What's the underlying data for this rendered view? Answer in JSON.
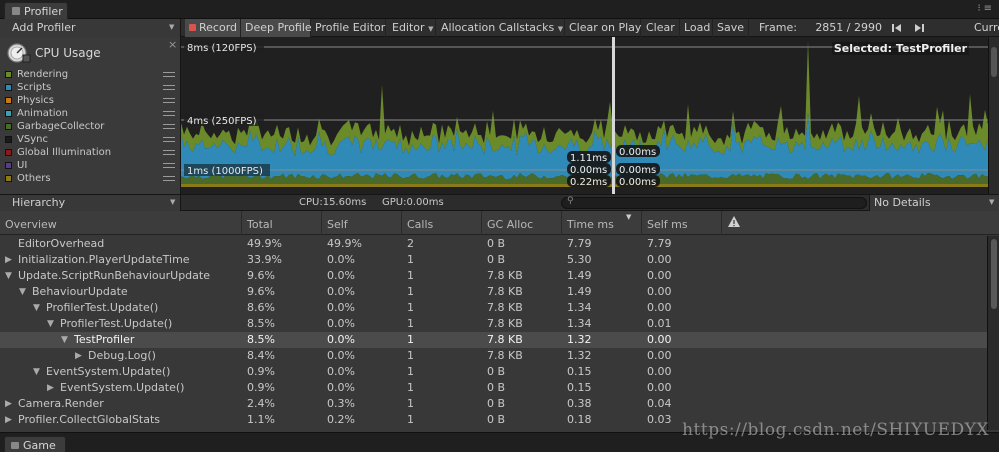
{
  "top_tab": {
    "label": "Profiler",
    "icon": "profiler-tab-icon"
  },
  "window_icons": "⁝≡",
  "toolbar": {
    "add_profiler": "Add Profiler",
    "record": "Record",
    "deep_profile": "Deep Profile",
    "profile_editor": "Profile Editor",
    "editor": "Editor",
    "allocation_callstacks": "Allocation Callstacks",
    "clear_on_play": "Clear on Play",
    "clear": "Clear",
    "load": "Load",
    "save": "Save",
    "frame_label": "Frame:",
    "frame_value": "2851 / 2990",
    "current": "Current"
  },
  "legend": {
    "title": "CPU Usage",
    "close": "×",
    "items": [
      {
        "label": "Rendering",
        "color": "#6b8a2a"
      },
      {
        "label": "Scripts",
        "color": "#2f8ab8"
      },
      {
        "label": "Physics",
        "color": "#c47a1a"
      },
      {
        "label": "Animation",
        "color": "#3aa0b8"
      },
      {
        "label": "GarbageCollector",
        "color": "#4a6a2a"
      },
      {
        "label": "VSync",
        "color": "#1a1a1a"
      },
      {
        "label": "Global Illumination",
        "color": "#8a1a1a"
      },
      {
        "label": "UI",
        "color": "#5a3a8a"
      },
      {
        "label": "Others",
        "color": "#8a7a1a"
      }
    ]
  },
  "chart": {
    "line_labels": [
      "8ms (120FPS)",
      "4ms (250FPS)",
      "1ms (1000FPS)"
    ],
    "selected": "Selected: TestProfiler",
    "selection_values_left": [
      "1.11ms",
      "0.00ms",
      "0.22ms"
    ],
    "selection_values_right": [
      "0.00ms",
      "0.00ms",
      "0.00ms"
    ]
  },
  "hierarchy_bar": {
    "dropdown": "Hierarchy",
    "cpu": "CPU:15.60ms",
    "gpu": "GPU:0.00ms",
    "details": "No Details"
  },
  "table": {
    "columns": [
      "Overview",
      "Total",
      "Self",
      "Calls",
      "GC Alloc",
      "Time ms",
      "Self ms"
    ],
    "rows": [
      {
        "name": "EditorOverhead",
        "depth": 0,
        "fold": "",
        "total": "49.9%",
        "self": "49.9%",
        "calls": "2",
        "gc": "0 B",
        "time": "7.79",
        "selfms": "7.79"
      },
      {
        "name": "Initialization.PlayerUpdateTime",
        "depth": 0,
        "fold": "▶",
        "total": "33.9%",
        "self": "0.0%",
        "calls": "1",
        "gc": "0 B",
        "time": "5.30",
        "selfms": "0.00"
      },
      {
        "name": "Update.ScriptRunBehaviourUpdate",
        "depth": 0,
        "fold": "▼",
        "total": "9.6%",
        "self": "0.0%",
        "calls": "1",
        "gc": "7.8 KB",
        "time": "1.49",
        "selfms": "0.00"
      },
      {
        "name": "BehaviourUpdate",
        "depth": 1,
        "fold": "▼",
        "total": "9.6%",
        "self": "0.0%",
        "calls": "1",
        "gc": "7.8 KB",
        "time": "1.49",
        "selfms": "0.00"
      },
      {
        "name": "ProfilerTest.Update()",
        "depth": 2,
        "fold": "▼",
        "total": "8.6%",
        "self": "0.0%",
        "calls": "1",
        "gc": "7.8 KB",
        "time": "1.34",
        "selfms": "0.00"
      },
      {
        "name": "ProfilerTest.Update()",
        "depth": 3,
        "fold": "▼",
        "total": "8.5%",
        "self": "0.0%",
        "calls": "1",
        "gc": "7.8 KB",
        "time": "1.34",
        "selfms": "0.01"
      },
      {
        "name": "TestProfiler",
        "depth": 4,
        "fold": "▼",
        "total": "8.5%",
        "self": "0.0%",
        "calls": "1",
        "gc": "7.8 KB",
        "time": "1.32",
        "selfms": "0.00",
        "selected": true
      },
      {
        "name": "Debug.Log()",
        "depth": 5,
        "fold": "▶",
        "total": "8.4%",
        "self": "0.0%",
        "calls": "1",
        "gc": "7.8 KB",
        "time": "1.32",
        "selfms": "0.00"
      },
      {
        "name": "EventSystem.Update()",
        "depth": 2,
        "fold": "▼",
        "total": "0.9%",
        "self": "0.0%",
        "calls": "1",
        "gc": "0 B",
        "time": "0.15",
        "selfms": "0.00"
      },
      {
        "name": "EventSystem.Update()",
        "depth": 3,
        "fold": "▶",
        "total": "0.9%",
        "self": "0.0%",
        "calls": "1",
        "gc": "0 B",
        "time": "0.15",
        "selfms": "0.00"
      },
      {
        "name": "Camera.Render",
        "depth": 0,
        "fold": "▶",
        "total": "2.4%",
        "self": "0.3%",
        "calls": "1",
        "gc": "0 B",
        "time": "0.38",
        "selfms": "0.04"
      },
      {
        "name": "Profiler.CollectGlobalStats",
        "depth": 0,
        "fold": "▶",
        "total": "1.1%",
        "self": "0.2%",
        "calls": "1",
        "gc": "0 B",
        "time": "0.18",
        "selfms": "0.03"
      }
    ]
  },
  "bottom_tab": {
    "label": "Game"
  },
  "watermark": "https://blog.csdn.net/SHIYUEDYX"
}
